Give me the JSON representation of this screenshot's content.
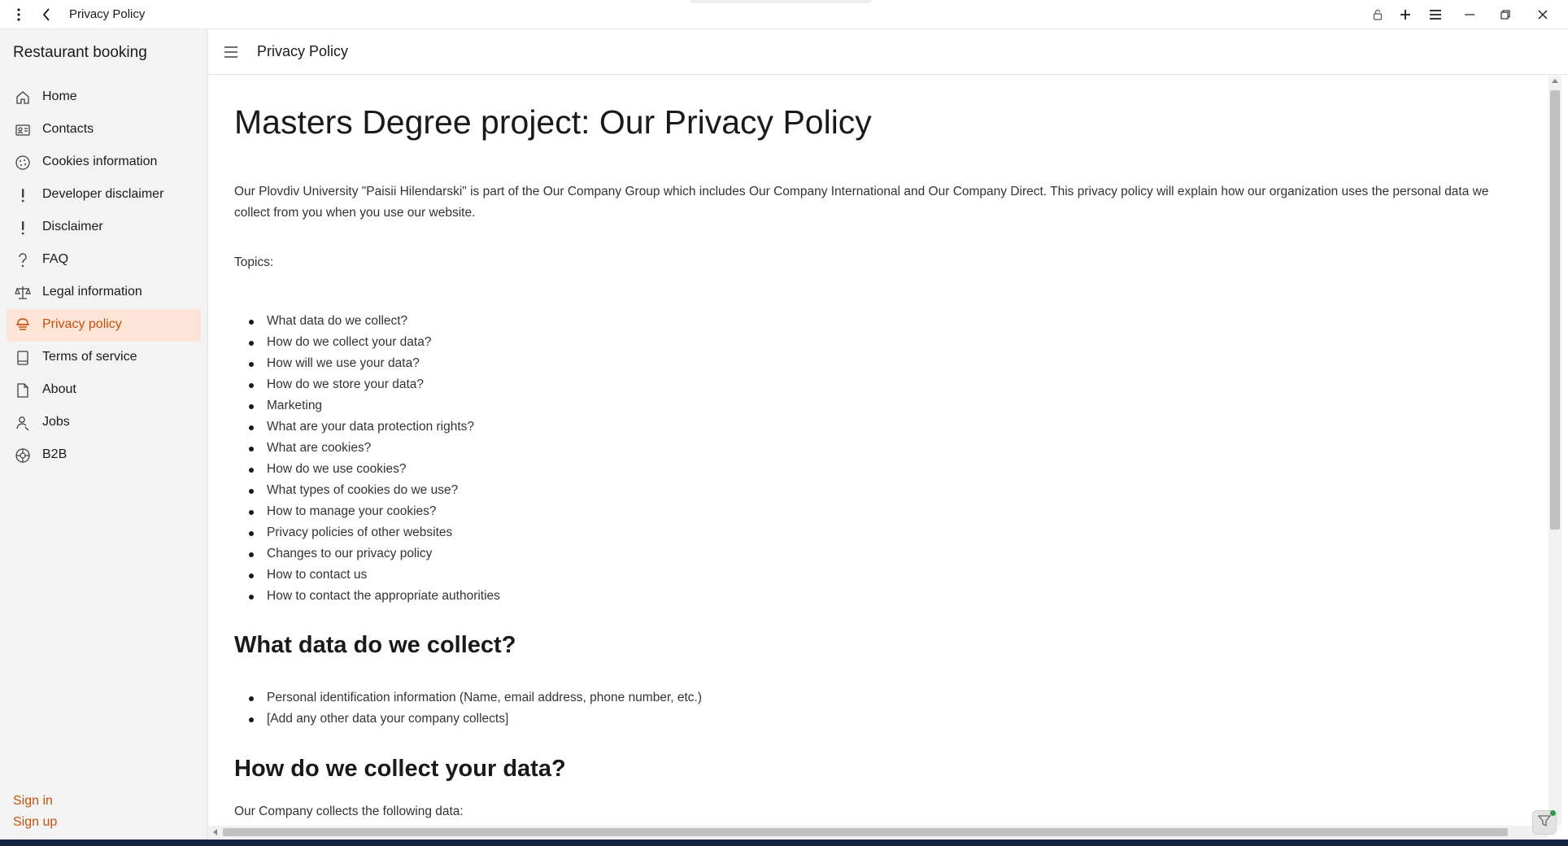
{
  "window": {
    "title": "Privacy Policy"
  },
  "sidebar": {
    "app_title": "Restaurant booking",
    "items": [
      {
        "label": "Home",
        "icon": "home-icon"
      },
      {
        "label": "Contacts",
        "icon": "contact-card-icon"
      },
      {
        "label": "Cookies information",
        "icon": "cookie-icon"
      },
      {
        "label": "Developer disclaimer",
        "icon": "exclamation-icon"
      },
      {
        "label": "Disclaimer",
        "icon": "exclamation-icon"
      },
      {
        "label": "FAQ",
        "icon": "question-icon"
      },
      {
        "label": "Legal information",
        "icon": "scales-icon"
      },
      {
        "label": "Privacy policy",
        "icon": "privacy-icon",
        "active": true
      },
      {
        "label": "Terms of service",
        "icon": "document-icon"
      },
      {
        "label": "About",
        "icon": "page-icon"
      },
      {
        "label": "Jobs",
        "icon": "person-icon"
      },
      {
        "label": "B2B",
        "icon": "globe-icon"
      }
    ],
    "sign_in": "Sign in",
    "sign_up": "Sign up"
  },
  "header": {
    "title": "Privacy Policy"
  },
  "content": {
    "title": "Masters Degree project: Our Privacy Policy",
    "intro": "Our Plovdiv University \"Paisii Hilendarski\" is part of the Our Company Group which includes Our Company International and Our Company Direct. This privacy policy will explain how our organization uses the personal data we collect from you when you use our website.",
    "topics_label": "Topics:",
    "topics": [
      "What data do we collect?",
      "How do we collect your data?",
      "How will we use your data?",
      "How do we store your data?",
      "Marketing",
      "What are your data protection rights?",
      "What are cookies?",
      "How do we use cookies?",
      "What types of cookies do we use?",
      "How to manage your cookies?",
      "Privacy policies of other websites",
      "Changes to our privacy policy",
      "How to contact us",
      "How to contact the appropriate authorities"
    ],
    "section1_heading": "What data do we collect?",
    "section1_items": [
      "Personal identification information (Name, email address, phone number, etc.)",
      "[Add any other data your company collects]"
    ],
    "section2_heading": "How do we collect your data?",
    "section2_text": "Our Company collects the following data:"
  },
  "colors": {
    "accent": "#c4510b",
    "active_bg": "#fce4d6",
    "sidebar_bg": "#f3f3f3"
  }
}
